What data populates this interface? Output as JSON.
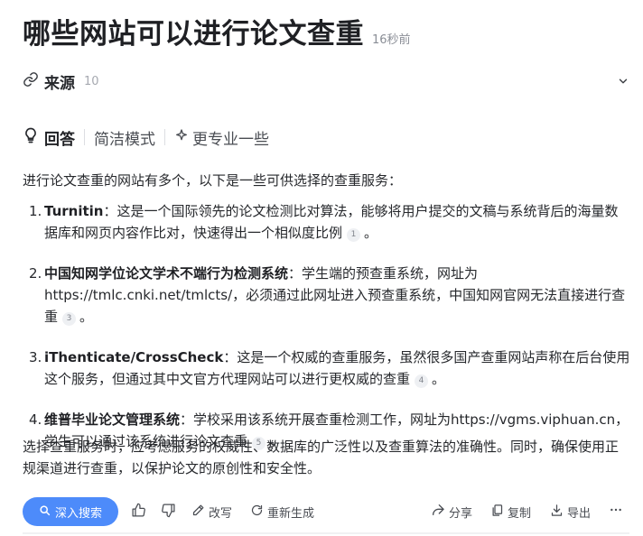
{
  "header": {
    "title": "哪些网站可以进行论文查重",
    "time": "16秒前"
  },
  "source": {
    "label": "来源",
    "count": "10"
  },
  "tabs": {
    "answer": "回答",
    "concise": "简洁模式",
    "pro": "更专业一些"
  },
  "answer": {
    "intro": "进行论文查重的网站有多个，以下是一些可供选择的查重服务：",
    "items": [
      {
        "num": "1.",
        "name": "Turnitin",
        "text": "：这是一个国际领先的论文检测比对算法，能够将用户提交的文稿与系统背后的海量数据库和网页内容作比对，快速得出一个相似度比例",
        "cite": "1",
        "end": "。"
      },
      {
        "num": "2.",
        "name": "中国知网学位论文学术不端行为检测系统",
        "text": "：学生端的预查重系统，网址为https://tmlc.cnki.net/tmlcts/，必须通过此网址进入预查重系统，中国知网官网无法直接进行查重",
        "cite": "3",
        "end": "。"
      },
      {
        "num": "3.",
        "name": "iThenticate/CrossCheck",
        "text": "：这是一个权威的查重服务，虽然很多国产查重网站声称在后台使用这个服务，但通过其中文官方代理网站可以进行更权威的查重",
        "cite": "4",
        "end": "。"
      },
      {
        "num": "4.",
        "name": "维普毕业论文管理系统",
        "text": "：学校采用该系统开展查重检测工作，网址为https://vgms.viphuan.cn，学生可以通过该系统进行论文查重",
        "cite": "5",
        "end": "。"
      }
    ],
    "conclusion": "选择查重服务时，应考虑服务的权威性、数据库的广泛性以及查重算法的准确性。同时，确保使用正规渠道进行查重，以保护论文的原创性和安全性。"
  },
  "actions": {
    "deep_search": "深入搜索",
    "rewrite": "改写",
    "regenerate": "重新生成",
    "share": "分享",
    "copy": "复制",
    "export": "导出"
  },
  "colors": {
    "accent": "#4d8bfa",
    "text": "#26282c",
    "muted": "#8a8e96"
  },
  "icons": [
    "link-icon",
    "chevron-down-icon",
    "lightbulb-icon",
    "sparkle-icon",
    "search-icon",
    "thumbs-up-icon",
    "thumbs-down-icon",
    "pen-icon",
    "refresh-icon",
    "share-icon",
    "copy-icon",
    "export-icon",
    "more-icon"
  ]
}
